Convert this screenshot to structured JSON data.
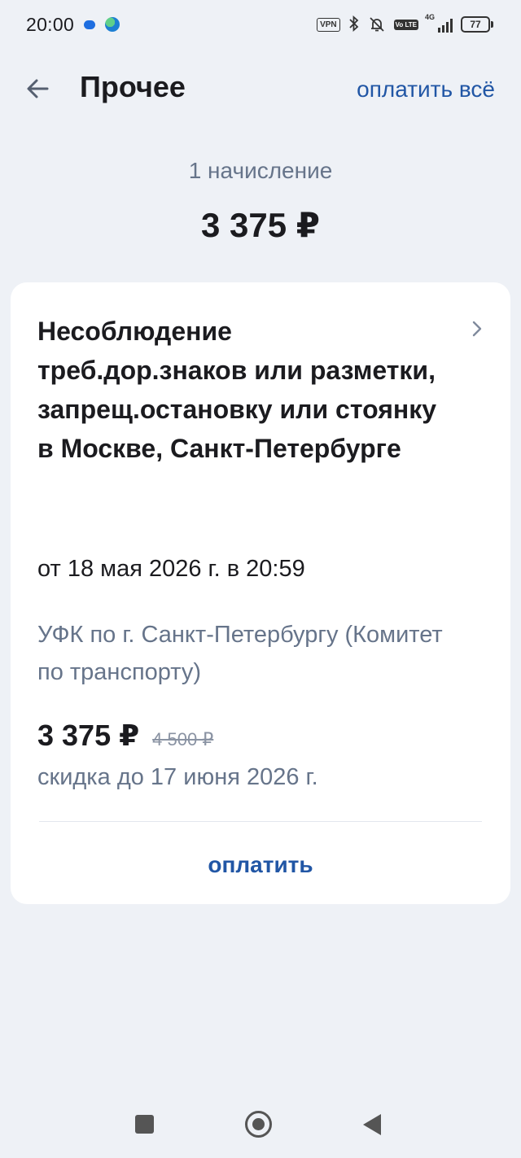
{
  "status_bar": {
    "time": "20:00",
    "icons": [
      "message-icon",
      "globe-icon",
      "vpn-icon",
      "bluetooth-icon",
      "mute-icon",
      "volte-icon",
      "signal-icon",
      "battery-icon"
    ],
    "vpn_label": "VPN",
    "network_label": "4G",
    "volte_label": "Vo LTE",
    "battery_level": "77"
  },
  "header": {
    "title": "Прочее",
    "pay_all_label": "оплатить всё",
    "back_icon": "arrow-left-icon"
  },
  "summary": {
    "count_label": "1 начисление",
    "total": "3 375 ₽"
  },
  "charge": {
    "title": "Несоблюдение треб.дор.знаков или разметки, запрещ.остановку или стоянку в Москве, Санкт-Петербурге",
    "date": "от 18 мая 2026 г. в 20:59",
    "recipient": "УФК по г. Санкт-Петербургу (Комитет по транспорту)",
    "price": "3 375 ₽",
    "old_price": "4 500 ₽",
    "discount_note": "скидка до 17 июня 2026 г.",
    "pay_label": "оплатить"
  },
  "colors": {
    "accent": "#2156a5",
    "background": "#eef1f6",
    "card": "#ffffff",
    "secondary_text": "#66748a"
  }
}
